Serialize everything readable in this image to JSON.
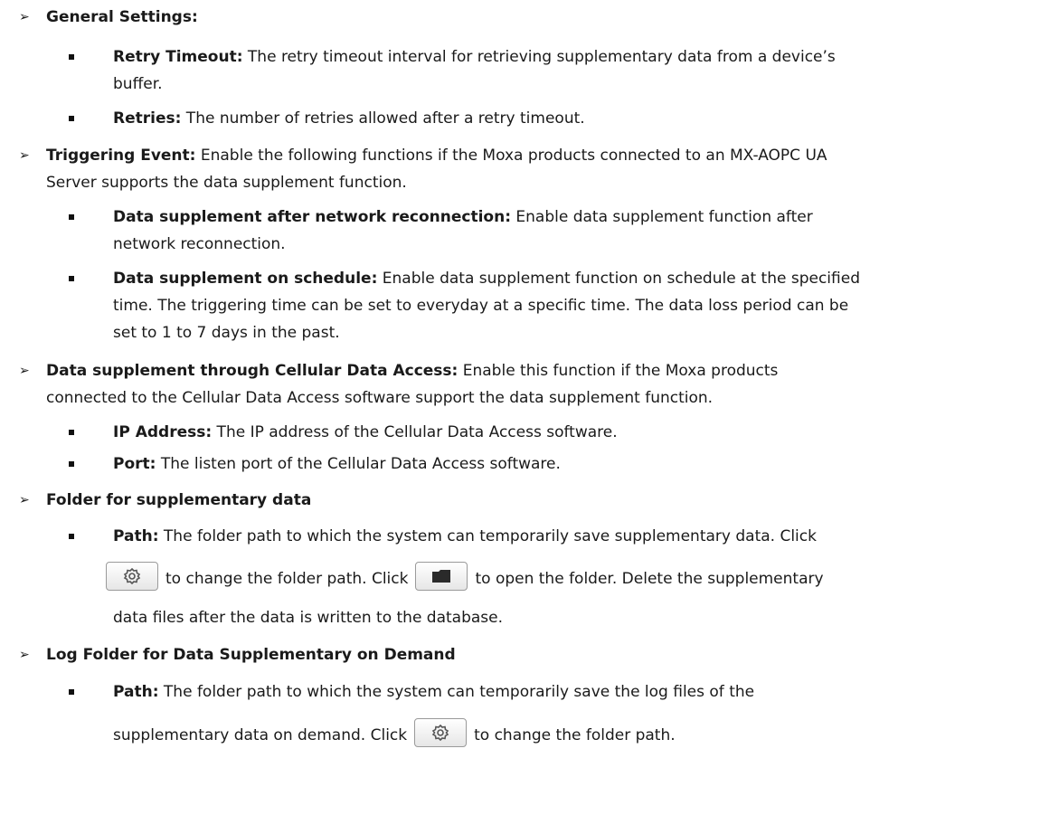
{
  "general": {
    "heading": "General Settings:",
    "retry_timeout_term": "Retry Timeout:",
    "retry_timeout_desc_1": " The retry timeout interval for retrieving supplementary data from a device’s",
    "retry_timeout_desc_2": "buffer.",
    "retries_term": "Retries:",
    "retries_desc": " The number of retries allowed after a retry timeout."
  },
  "triggering": {
    "term": "Triggering Event:",
    "desc_1": " Enable the following functions if the Moxa products connected to an MX-AOPC UA",
    "desc_2": "Server supports the data supplement function.",
    "reconnect_term": "Data supplement after network reconnection:",
    "reconnect_desc_1": " Enable data supplement function after",
    "reconnect_desc_2": "network reconnection.",
    "schedule_term": "Data supplement on schedule:",
    "schedule_desc_1": " Enable data supplement function on schedule at the specified",
    "schedule_desc_2": "time. The triggering time can be set to everyday at a specific time. The data loss period can be",
    "schedule_desc_3": "set to 1 to 7 days in the past."
  },
  "cellular": {
    "term": "Data supplement through Cellular Data Access:",
    "desc_1": " Enable this function if the Moxa products",
    "desc_2": "connected to the Cellular Data Access software support the data supplement function.",
    "ip_term": "IP Address:",
    "ip_desc": " The IP address of the Cellular Data Access software.",
    "port_term": "Port:",
    "port_desc": " The listen port of the Cellular Data Access software."
  },
  "folder": {
    "heading": "Folder for supplementary data",
    "path_term": "Path:",
    "path_desc_1": " The folder path to which the system can temporarily save supplementary data. Click",
    "change_text": "to change the folder path. Click",
    "open_text": "to open the folder. Delete the supplementary",
    "path_desc_3": "data files after the data is written to the database."
  },
  "log": {
    "heading": "Log Folder for Data Supplementary on Demand",
    "path_term": "Path:",
    "path_desc_1": " The folder path to which the system can temporarily save the log files of the",
    "path_desc_2": "supplementary data on demand. Click",
    "change_text": "to change the folder path."
  },
  "icons": {
    "settings_button": "gear-icon",
    "open_folder_button": "folder-icon"
  }
}
